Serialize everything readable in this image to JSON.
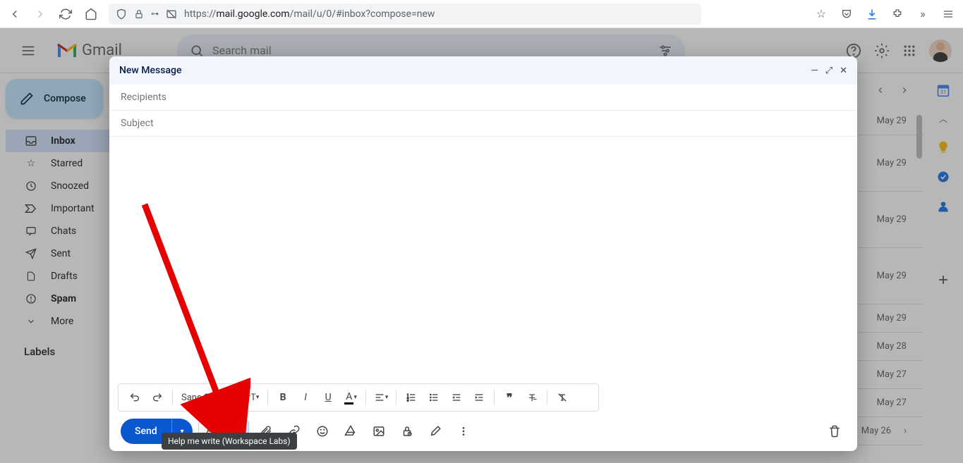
{
  "browser": {
    "url_host": "mail.google.com",
    "url_prefix": "https://",
    "url_path": "/mail/u/0/#inbox?compose=new"
  },
  "gmail": {
    "logo": "Gmail",
    "search_placeholder": "Search mail"
  },
  "sidebar": {
    "compose": "Compose",
    "items": [
      {
        "label": "Inbox",
        "icon": "inbox"
      },
      {
        "label": "Starred",
        "icon": "star"
      },
      {
        "label": "Snoozed",
        "icon": "clock"
      },
      {
        "label": "Important",
        "icon": "important"
      },
      {
        "label": "Chats",
        "icon": "chat"
      },
      {
        "label": "Sent",
        "icon": "sent"
      },
      {
        "label": "Drafts",
        "icon": "draft"
      },
      {
        "label": "Spam",
        "icon": "spam"
      },
      {
        "label": "More",
        "icon": "more"
      }
    ],
    "labels_header": "Labels"
  },
  "inbox_dates": [
    "May 29",
    "May 29",
    "May 29",
    "May 29",
    "May 29",
    "May 28",
    "May 27",
    "May 27",
    "May 26"
  ],
  "compose": {
    "title": "New Message",
    "recipients": "Recipients",
    "subject": "Subject",
    "send": "Send",
    "font": "Sans Serif"
  },
  "tooltip": "Help me write (Workspace Labs)"
}
